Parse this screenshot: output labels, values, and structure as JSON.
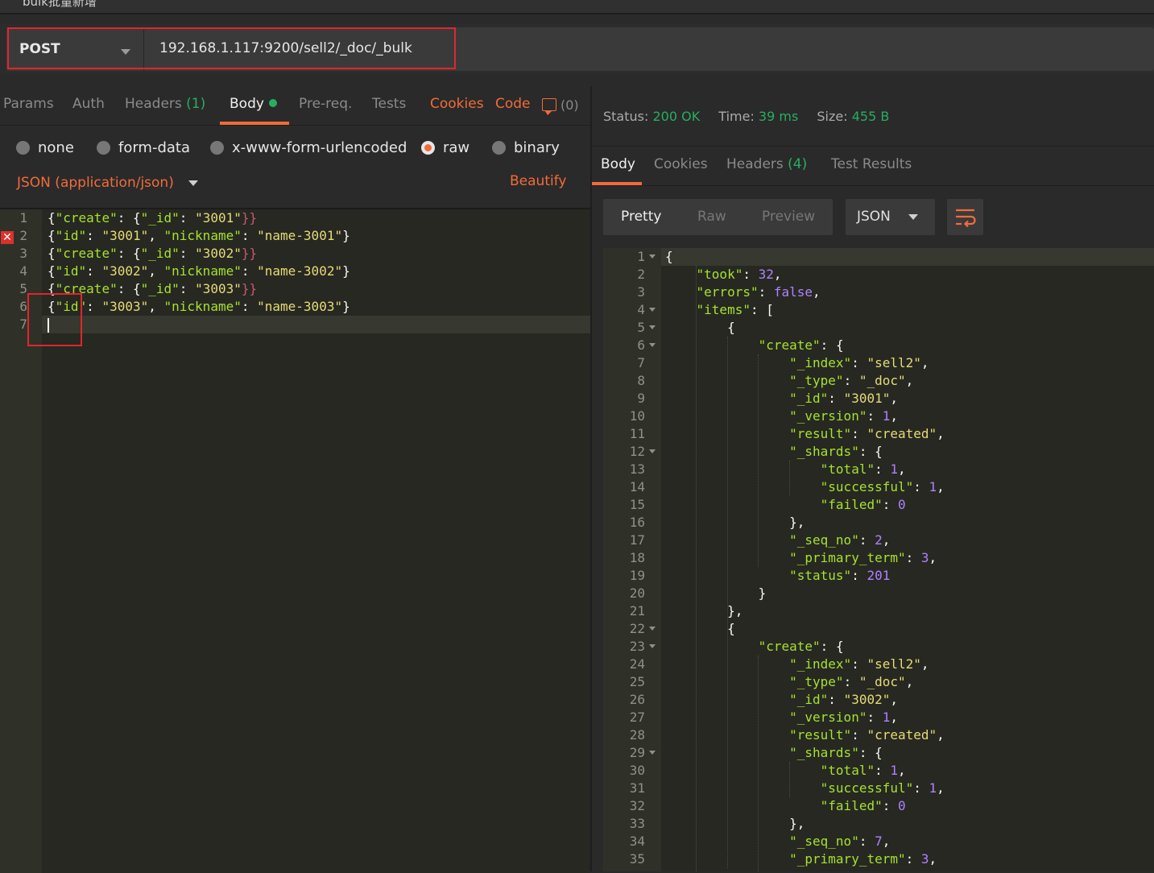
{
  "window": {
    "title": "bulk批量新增"
  },
  "request": {
    "method": "POST",
    "url": "192.168.1.117:9200/sell2/_doc/_bulk"
  },
  "request_tabs": [
    {
      "label": "Params"
    },
    {
      "label": "Auth"
    },
    {
      "label": "Headers",
      "count": "(1)"
    },
    {
      "label": "Body"
    },
    {
      "label": "Pre-req."
    },
    {
      "label": "Tests"
    }
  ],
  "request_links": {
    "cookies": "Cookies",
    "code": "Code",
    "comments": "(0)"
  },
  "body_modes": [
    {
      "label": "none",
      "selected": false
    },
    {
      "label": "form-data",
      "selected": false
    },
    {
      "label": "x-www-form-urlencoded",
      "selected": false
    },
    {
      "label": "raw",
      "selected": true
    },
    {
      "label": "binary",
      "selected": false
    }
  ],
  "content_type": "JSON (application/json)",
  "beautify": "Beautify",
  "editor": {
    "error_line": 2,
    "active_line": 7,
    "lines": [
      {
        "n": "1",
        "text": "{\"create\": {\"_id\": \"3001\"}}"
      },
      {
        "n": "2",
        "text": "{\"id\": \"3001\", \"nickname\": \"name-3001\"}"
      },
      {
        "n": "3",
        "text": "{\"create\": {\"_id\": \"3002\"}}"
      },
      {
        "n": "4",
        "text": "{\"id\": \"3002\", \"nickname\": \"name-3002\"}"
      },
      {
        "n": "5",
        "text": "{\"create\": {\"_id\": \"3003\"}}"
      },
      {
        "n": "6",
        "text": "{\"id\": \"3003\", \"nickname\": \"name-3003\"}"
      },
      {
        "n": "7",
        "text": ""
      }
    ]
  },
  "response_status": {
    "status_label": "Status:",
    "status_value": "200 OK",
    "time_label": "Time:",
    "time_value": "39 ms",
    "size_label": "Size:",
    "size_value": "455 B"
  },
  "response_tabs": [
    {
      "label": "Body"
    },
    {
      "label": "Cookies"
    },
    {
      "label": "Headers",
      "count": "(4)"
    },
    {
      "label": "Test Results"
    }
  ],
  "view_modes": [
    "Pretty",
    "Raw",
    "Preview"
  ],
  "response_format": "JSON",
  "icons": {
    "wrap": "wrap-lines-icon",
    "error": "error-x-icon",
    "comment": "comment-icon"
  },
  "colors": {
    "accent": "#f26b3a",
    "success": "#27ae60",
    "error": "#e0262a"
  },
  "response_lines": [
    {
      "n": "1",
      "fold": true,
      "text": "{"
    },
    {
      "n": "2",
      "text": "    \"took\": 32,"
    },
    {
      "n": "3",
      "text": "    \"errors\": false,"
    },
    {
      "n": "4",
      "fold": true,
      "text": "    \"items\": ["
    },
    {
      "n": "5",
      "fold": true,
      "text": "        {"
    },
    {
      "n": "6",
      "fold": true,
      "text": "            \"create\": {"
    },
    {
      "n": "7",
      "text": "                \"_index\": \"sell2\","
    },
    {
      "n": "8",
      "text": "                \"_type\": \"_doc\","
    },
    {
      "n": "9",
      "text": "                \"_id\": \"3001\","
    },
    {
      "n": "10",
      "text": "                \"_version\": 1,"
    },
    {
      "n": "11",
      "text": "                \"result\": \"created\","
    },
    {
      "n": "12",
      "fold": true,
      "text": "                \"_shards\": {"
    },
    {
      "n": "13",
      "text": "                    \"total\": 1,"
    },
    {
      "n": "14",
      "text": "                    \"successful\": 1,"
    },
    {
      "n": "15",
      "text": "                    \"failed\": 0"
    },
    {
      "n": "16",
      "text": "                },"
    },
    {
      "n": "17",
      "text": "                \"_seq_no\": 2,"
    },
    {
      "n": "18",
      "text": "                \"_primary_term\": 3,"
    },
    {
      "n": "19",
      "text": "                \"status\": 201"
    },
    {
      "n": "20",
      "text": "            }"
    },
    {
      "n": "21",
      "text": "        },"
    },
    {
      "n": "22",
      "fold": true,
      "text": "        {"
    },
    {
      "n": "23",
      "fold": true,
      "text": "            \"create\": {"
    },
    {
      "n": "24",
      "text": "                \"_index\": \"sell2\","
    },
    {
      "n": "25",
      "text": "                \"_type\": \"_doc\","
    },
    {
      "n": "26",
      "text": "                \"_id\": \"3002\","
    },
    {
      "n": "27",
      "text": "                \"_version\": 1,"
    },
    {
      "n": "28",
      "text": "                \"result\": \"created\","
    },
    {
      "n": "29",
      "fold": true,
      "text": "                \"_shards\": {"
    },
    {
      "n": "30",
      "text": "                    \"total\": 1,"
    },
    {
      "n": "31",
      "text": "                    \"successful\": 1,"
    },
    {
      "n": "32",
      "text": "                    \"failed\": 0"
    },
    {
      "n": "33",
      "text": "                },"
    },
    {
      "n": "34",
      "text": "                \"_seq_no\": 7,"
    },
    {
      "n": "35",
      "text": "                \"_primary_term\": 3,"
    }
  ]
}
